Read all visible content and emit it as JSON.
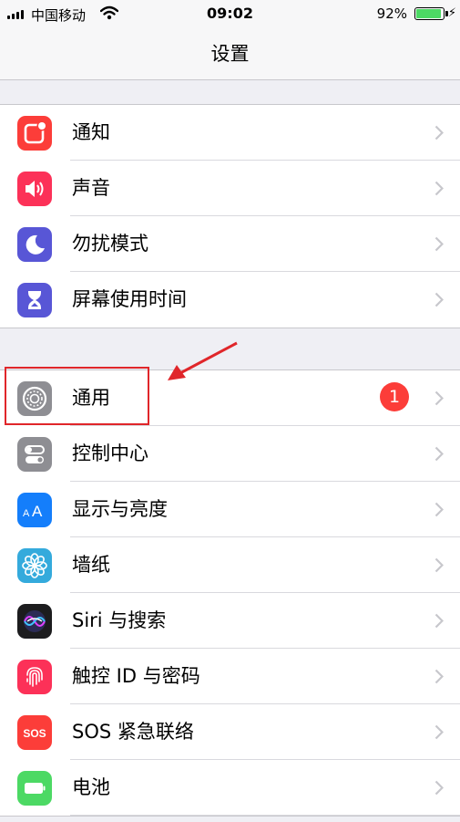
{
  "status_bar": {
    "carrier": "中国移动",
    "time": "09:02",
    "battery_pct": "92%",
    "battery_level": 0.92
  },
  "nav": {
    "title": "设置"
  },
  "group1": [
    {
      "label": "通知",
      "icon": "notifications-icon",
      "color": "#fc3d39"
    },
    {
      "label": "声音",
      "icon": "sounds-icon",
      "color": "#fc3158"
    },
    {
      "label": "勿扰模式",
      "icon": "do-not-disturb-moon-icon",
      "color": "#5856d6"
    },
    {
      "label": "屏幕使用时间",
      "icon": "screen-time-hourglass-icon",
      "color": "#5856d6"
    }
  ],
  "group2": [
    {
      "label": "通用",
      "icon": "general-gear-icon",
      "color": "#8e8e93",
      "badge": "1"
    },
    {
      "label": "控制中心",
      "icon": "control-center-icon",
      "color": "#8e8e93"
    },
    {
      "label": "显示与亮度",
      "icon": "display-brightness-icon",
      "color": "#147efb"
    },
    {
      "label": "墙纸",
      "icon": "wallpaper-flower-icon",
      "color": "#34aadc"
    },
    {
      "label": "Siri 与搜索",
      "icon": "siri-icon",
      "color": "#1c1c1e"
    },
    {
      "label": "触控 ID 与密码",
      "icon": "touch-id-fingerprint-icon",
      "color": "#fc3158"
    },
    {
      "label": "SOS 紧急联络",
      "icon": "sos-icon",
      "color": "#fc3d39",
      "icon_text": "SOS"
    },
    {
      "label": "电池",
      "icon": "battery-icon",
      "color": "#4cd964"
    }
  ]
}
